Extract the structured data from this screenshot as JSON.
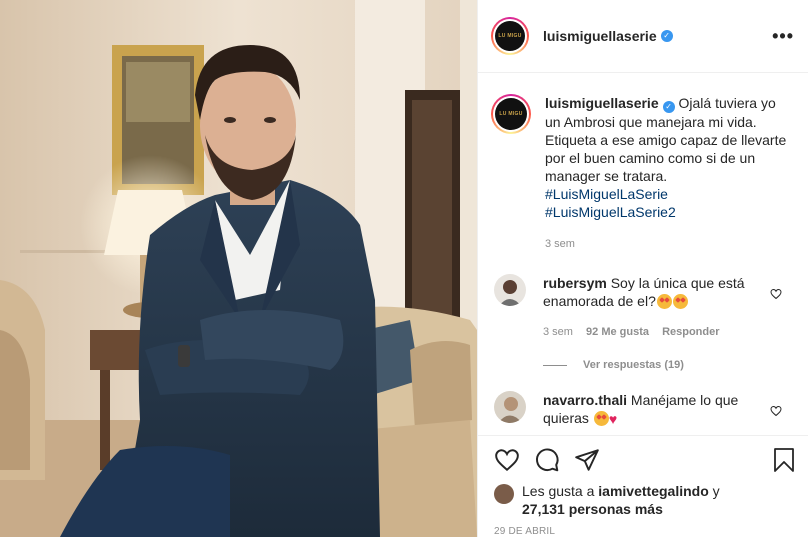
{
  "post": {
    "username": "luismiguellaserie",
    "avatar_text": "LU MIGU",
    "more_icon": "more-options-icon",
    "caption_text": "Ojalá tuviera yo un Ambrosi que manejara mi vida. Etiqueta a ese amigo capaz de llevarte por el buen camino como si de un manager se tratara.",
    "hashtags": [
      "#LuisMiguelLaSerie",
      "#LuisMiguelLaSerie2"
    ],
    "caption_time": "3 sem"
  },
  "comments": [
    {
      "username": "rubersym",
      "text": "Soy la única que está enamorada de el?",
      "time": "3 sem",
      "likes": "92 Me gusta",
      "reply": "Responder",
      "view_replies": "Ver respuestas (19)"
    },
    {
      "username": "navarro.thali",
      "text": "Manéjame lo que quieras"
    }
  ],
  "footer": {
    "likes_prefix": "Les gusta a",
    "liker": "iamivettegalindo",
    "likes_joiner": "y",
    "likes_count": "27,131 personas más",
    "date": "29 DE ABRIL"
  },
  "colors": {
    "link": "#00376b",
    "verified": "#3897f0",
    "muted": "#8e8e8e"
  }
}
